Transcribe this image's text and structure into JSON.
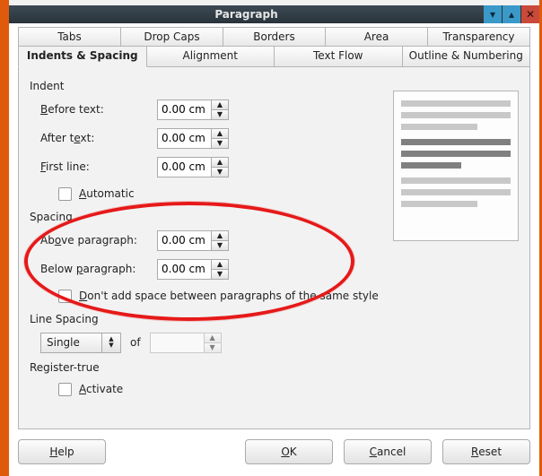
{
  "window": {
    "title": "Paragraph"
  },
  "tabs_top": [
    {
      "label": "Tabs"
    },
    {
      "label": "Drop Caps"
    },
    {
      "label": "Borders"
    },
    {
      "label": "Area"
    },
    {
      "label": "Transparency"
    }
  ],
  "tabs_bottom": [
    {
      "label": "Indents & Spacing",
      "active": true
    },
    {
      "label": "Alignment"
    },
    {
      "label": "Text Flow"
    },
    {
      "label": "Outline & Numbering"
    }
  ],
  "indent": {
    "section": "Indent",
    "before_label_pre": "",
    "before_u": "B",
    "before_label_post": "efore text:",
    "before_value": "0.00 cm",
    "after_label_pre": "After t",
    "after_u": "e",
    "after_label_post": "xt:",
    "after_value": "0.00 cm",
    "first_u": "F",
    "first_label_post": "irst line:",
    "first_value": "0.00 cm",
    "auto_u": "A",
    "auto_label_post": "utomatic"
  },
  "spacing": {
    "section": "Spacing",
    "above_label_pre": "Ab",
    "above_u": "o",
    "above_label_post": "ve paragraph:",
    "above_value": "0.00 cm",
    "below_label_pre": "Below ",
    "below_u": "p",
    "below_label_post": "aragraph:",
    "below_value": "0.00 cm",
    "nospace_u": "D",
    "nospace_post": "on't add space between paragraphs of the same style"
  },
  "linespacing": {
    "section": "Line Spacing",
    "value": "Single",
    "of": "of"
  },
  "register": {
    "section": "Register-true",
    "activate_u": "A",
    "activate_post": "ctivate"
  },
  "buttons": {
    "help": "Help",
    "ok": "OK",
    "cancel": "Cancel",
    "reset": "Reset"
  }
}
